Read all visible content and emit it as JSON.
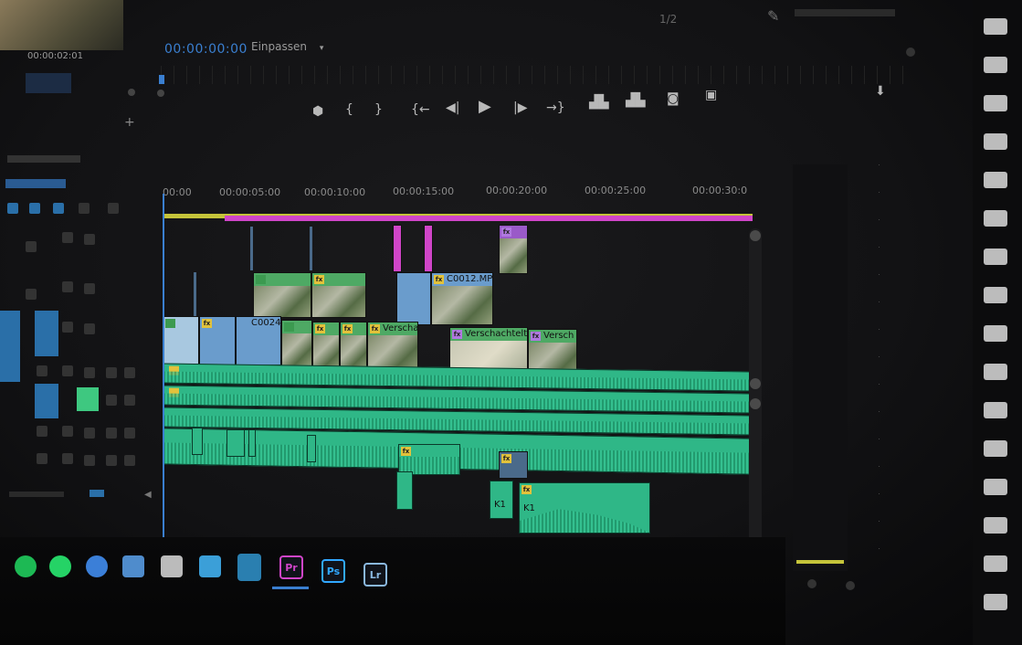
{
  "program": {
    "timecode": "00:00:00:00",
    "fit_label": "Einpassen",
    "top_right_readout": "1/2"
  },
  "source": {
    "timecode": "00:00:02:01"
  },
  "timeline": {
    "ruler_ticks": [
      "00:00",
      "00:00:05:00",
      "00:00:10:00",
      "00:00:15:00",
      "00:00:20:00",
      "00:00:25:00",
      "00:00:30:0"
    ],
    "clips": {
      "c0024": "C0024",
      "c0012": "C0012.MP",
      "verschachtelt_1": "Verschachtelt",
      "verschachtelt_2": "Verschachtelt",
      "verschachtelt_3": "Versch",
      "k1a": "K1",
      "k1b": "K1"
    }
  },
  "taskbar": {
    "icons": [
      {
        "label": "",
        "name": "spotify-icon",
        "color": "#1db954"
      },
      {
        "label": "",
        "name": "whatsapp-icon",
        "color": "#25d366"
      },
      {
        "label": "",
        "name": "browser-icon",
        "color": "#3b7fd8"
      },
      {
        "label": "",
        "name": "mail-icon",
        "color": "#4f8ccc"
      },
      {
        "label": "",
        "name": "media-encoder-icon",
        "color": "#bbbbbb"
      },
      {
        "label": "",
        "name": "bird-icon",
        "color": "#3b9fd8"
      },
      {
        "label": "",
        "name": "files-icon",
        "color": "#2a7fb0"
      },
      {
        "label": "Pr",
        "name": "premiere-icon",
        "color": "#d045c8"
      },
      {
        "label": "Ps",
        "name": "photoshop-icon",
        "color": "#31a8ff"
      },
      {
        "label": "Lr",
        "name": "lightroom-icon",
        "color": "#8ab8e0"
      }
    ]
  },
  "colors": {
    "accent": "#3a7fd0",
    "video_clip": "#4ea964",
    "audio_clip": "#2fb787",
    "work_area": "#c5c43a",
    "render_bar": "#d045c8"
  }
}
